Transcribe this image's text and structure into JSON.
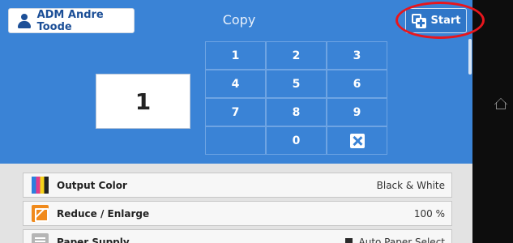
{
  "header": {
    "user_label": "ADM Andre Toode",
    "title": "Copy",
    "start_label": "Start"
  },
  "quantity": "1",
  "keypad": {
    "keys": [
      "1",
      "2",
      "3",
      "4",
      "5",
      "6",
      "7",
      "8",
      "9",
      "0"
    ]
  },
  "settings": {
    "output_color": {
      "label": "Output Color",
      "value": "Black & White"
    },
    "reduce_enlarge": {
      "label": "Reduce / Enlarge",
      "value": "100 %"
    },
    "paper_supply": {
      "label": "Paper Supply",
      "value": "Auto Paper Select"
    }
  },
  "colors": {
    "panel_blue": "#3a83d6",
    "highlight_red": "#e8161d",
    "button_text_blue": "#1c4f97"
  }
}
